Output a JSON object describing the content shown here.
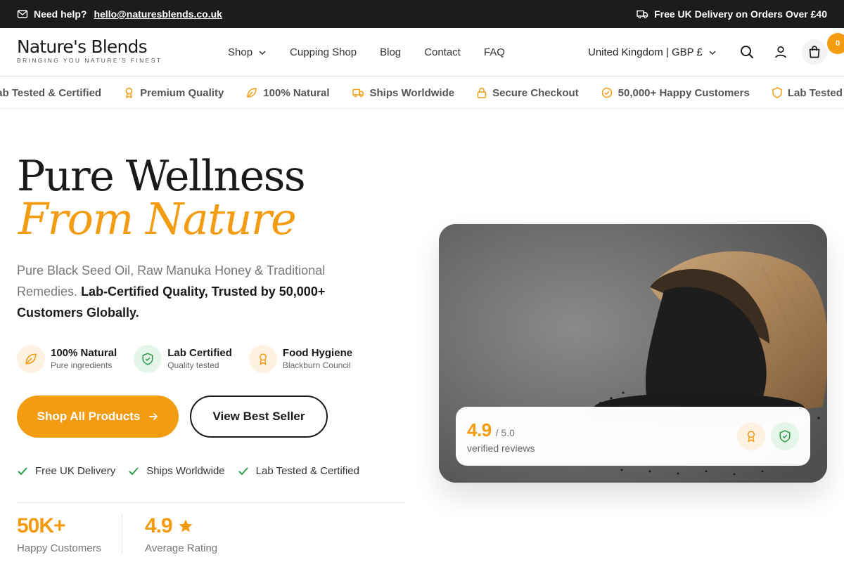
{
  "topbar": {
    "help_label": "Need help?",
    "email": "hello@naturesblends.co.uk",
    "delivery_text": "Free UK Delivery on Orders Over £40"
  },
  "header": {
    "logo_name": "Nature's Blends",
    "logo_tagline": "BRINGING YOU NATURE'S FINEST",
    "nav": [
      {
        "label": "Shop",
        "has_dropdown": true
      },
      {
        "label": "Cupping Shop"
      },
      {
        "label": "Blog"
      },
      {
        "label": "Contact"
      },
      {
        "label": "FAQ"
      }
    ],
    "locale": "United Kingdom | GBP £",
    "cart_count": "0",
    "icons": [
      "search-icon",
      "account-icon",
      "cart-icon"
    ]
  },
  "marquee": {
    "items": [
      {
        "label": "Lab Tested & Certified",
        "icon": "shield-icon"
      },
      {
        "label": "Premium Quality",
        "icon": "award-icon"
      },
      {
        "label": "100% Natural",
        "icon": "leaf-icon"
      },
      {
        "label": "Ships Worldwide",
        "icon": "truck-icon"
      },
      {
        "label": "Secure Checkout",
        "icon": "lock-icon"
      },
      {
        "label": "50,000+ Happy Customers",
        "icon": "check-circle-icon"
      },
      {
        "label": "Lab Tested & Certified",
        "icon": "shield-icon"
      }
    ]
  },
  "hero": {
    "title_line1": "Pure Wellness",
    "title_line2": "From Nature",
    "description_plain": "Pure Black Seed Oil, Raw Manuka Honey & Traditional Remedies.",
    "description_bold": "Lab-Certified Quality, Trusted by 50,000+ Customers Globally.",
    "features": [
      {
        "title": "100% Natural",
        "subtitle": "Pure ingredients",
        "icon": "leaf-icon"
      },
      {
        "title": "Lab Certified",
        "subtitle": "Quality tested",
        "icon": "shield-check-icon"
      },
      {
        "title": "Food Hygiene",
        "subtitle": "Blackburn Council",
        "icon": "award-icon"
      }
    ],
    "primary_button": "Shop All Products",
    "secondary_button": "View Best Seller",
    "checks": [
      "Free UK Delivery",
      "Ships Worldwide",
      "Lab Tested & Certified"
    ],
    "stats": [
      {
        "value": "50K+",
        "label": "Happy Customers"
      },
      {
        "value": "4.9",
        "label": "Average Rating"
      }
    ]
  },
  "rating_card": {
    "score": "4.9",
    "out_of": "/ 5.0",
    "caption": "verified reviews"
  },
  "colors": {
    "accent": "#f39c12",
    "dark": "#1c1c1c",
    "green": "#2e9e4f"
  }
}
